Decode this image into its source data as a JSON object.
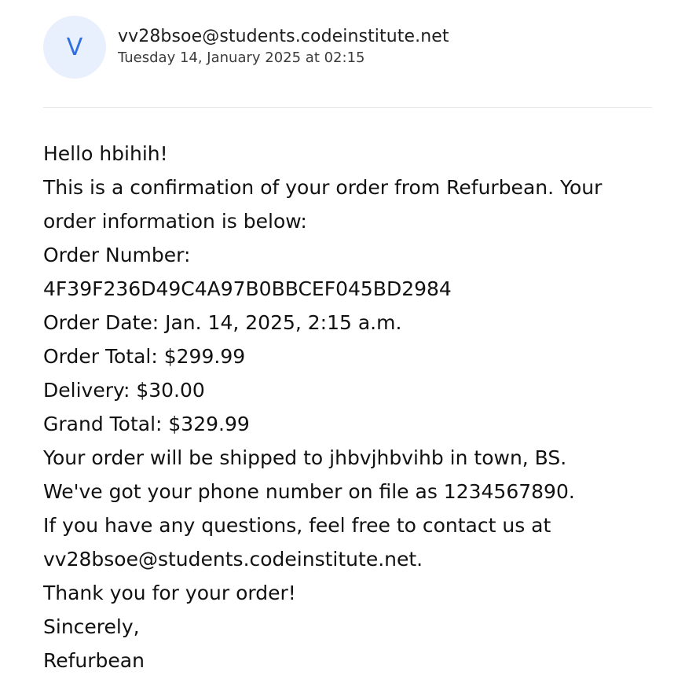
{
  "header": {
    "avatar_letter": "V",
    "sender_email": "vv28bsoe@students.codeinstitute.net",
    "sent_date": "Tuesday 14, January 2025 at 02:15"
  },
  "message": {
    "lines": [
      "Hello hbihih!",
      "This is a confirmation of your order from Refurbean. Your",
      "order information is below:",
      "Order Number:",
      "4F39F236D49C4A97B0BBCEF045BD2984",
      "Order Date: Jan. 14, 2025, 2:15 a.m.",
      "Order Total: $299.99",
      "Delivery: $30.00",
      "Grand Total: $329.99",
      "Your order will be shipped to jhbvjhbvihb in town, BS.",
      "We've got your phone number on file as 1234567890.",
      "If you have any questions, feel free to contact us at",
      "vv28bsoe@students.codeinstitute.net.",
      "Thank you for your order!",
      "Sincerely,",
      "Refurbean"
    ]
  }
}
